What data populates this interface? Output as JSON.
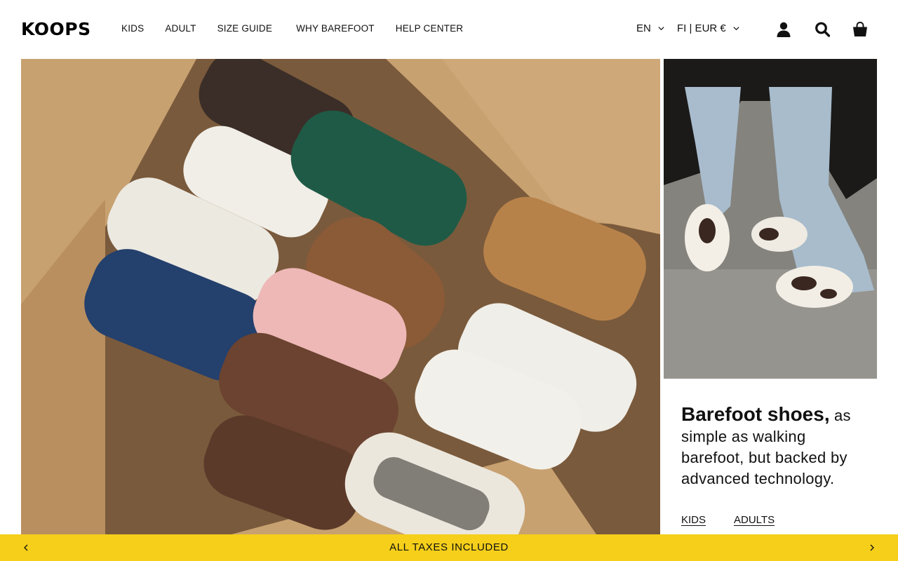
{
  "brand": {
    "logo_text": "KOOPS"
  },
  "nav": {
    "items": [
      "KIDS",
      "ADULT",
      "SIZE GUIDE",
      "WHY BAREFOOT",
      "HELP CENTER"
    ]
  },
  "header": {
    "language": "EN",
    "currency": "FI | EUR €"
  },
  "icons": {
    "account": "user-icon",
    "search": "search-icon",
    "cart": "bag-icon",
    "dropdown": "chevron-down-icon"
  },
  "hero": {
    "headline_bold": "Barefoot shoes,",
    "headline_rest": " as simple as walking barefoot, but backed by advanced technology.",
    "links": [
      "KIDS",
      "ADULTS"
    ]
  },
  "announcement": {
    "text": "ALL TAXES INCLUDED"
  },
  "colors": {
    "announcement_bg": "#f5cf1a",
    "text": "#111111",
    "background": "#ffffff"
  }
}
